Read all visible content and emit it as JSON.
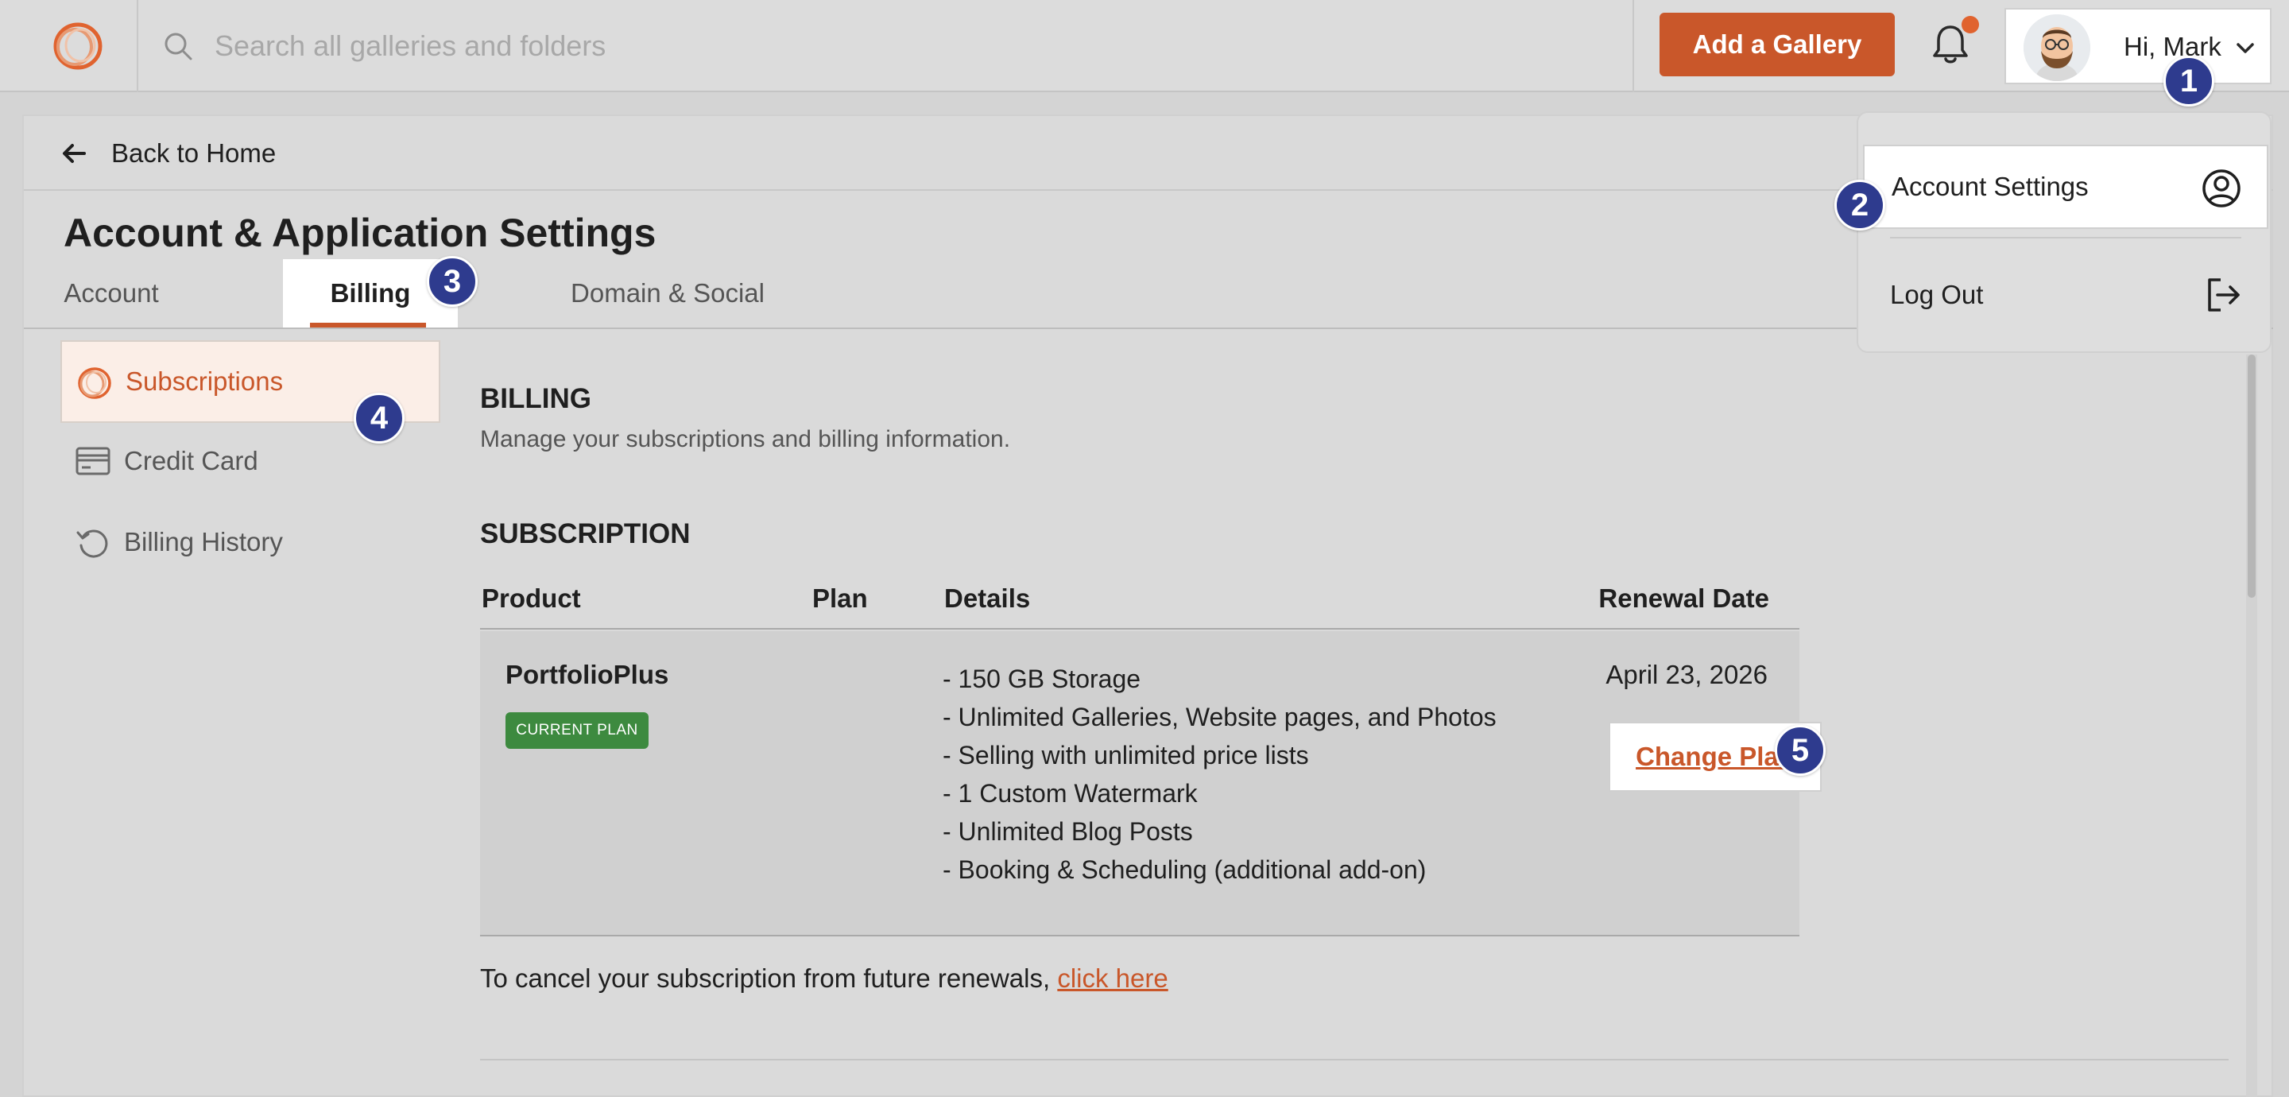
{
  "topbar": {
    "search_placeholder": "Search all galleries and folders",
    "add_gallery_label": "Add a Gallery",
    "user_greeting": "Hi, Mark"
  },
  "user_dropdown": {
    "items": [
      {
        "label": "Account Settings",
        "icon": "user-circle-icon"
      },
      {
        "label": "Log Out",
        "icon": "logout-icon"
      }
    ]
  },
  "page": {
    "back_label": "Back to Home",
    "title": "Account & Application Settings",
    "tabs": [
      {
        "label": "Account"
      },
      {
        "label": "Billing"
      },
      {
        "label": "Domain & Social"
      }
    ],
    "active_tab": "Billing"
  },
  "billing_nav": {
    "items": [
      {
        "label": "Subscriptions",
        "icon": "logo-ring-icon"
      },
      {
        "label": "Credit Card",
        "icon": "credit-card-icon"
      },
      {
        "label": "Billing History",
        "icon": "history-icon"
      }
    ],
    "active_item": "Subscriptions"
  },
  "billing": {
    "title": "BILLING",
    "description": "Manage your subscriptions and billing information.",
    "subscription_title": "SUBSCRIPTION",
    "table": {
      "headers": [
        "Product",
        "Plan",
        "Details",
        "Renewal Date"
      ],
      "rows": [
        {
          "product": "PortfolioPlus",
          "badge": "CURRENT PLAN",
          "plan": "",
          "details": [
            "- 150 GB Storage",
            "- Unlimited Galleries, Website pages, and Photos",
            "- Selling with unlimited price lists",
            "- 1 Custom Watermark",
            "- Unlimited Blog Posts",
            "- Booking & Scheduling (additional add-on)"
          ],
          "renewal_date": "April 23, 2026",
          "action_label": "Change Plan"
        }
      ]
    },
    "cancel_text": "To cancel your subscription from future renewals, ",
    "cancel_link": "click here"
  },
  "step_markers": [
    "1",
    "2",
    "3",
    "4",
    "5"
  ],
  "colors": {
    "accent": "#c9572a",
    "badge_green": "#3d8a3f",
    "step_marker": "#2e3b8e",
    "notification_dot": "#e0632f"
  }
}
